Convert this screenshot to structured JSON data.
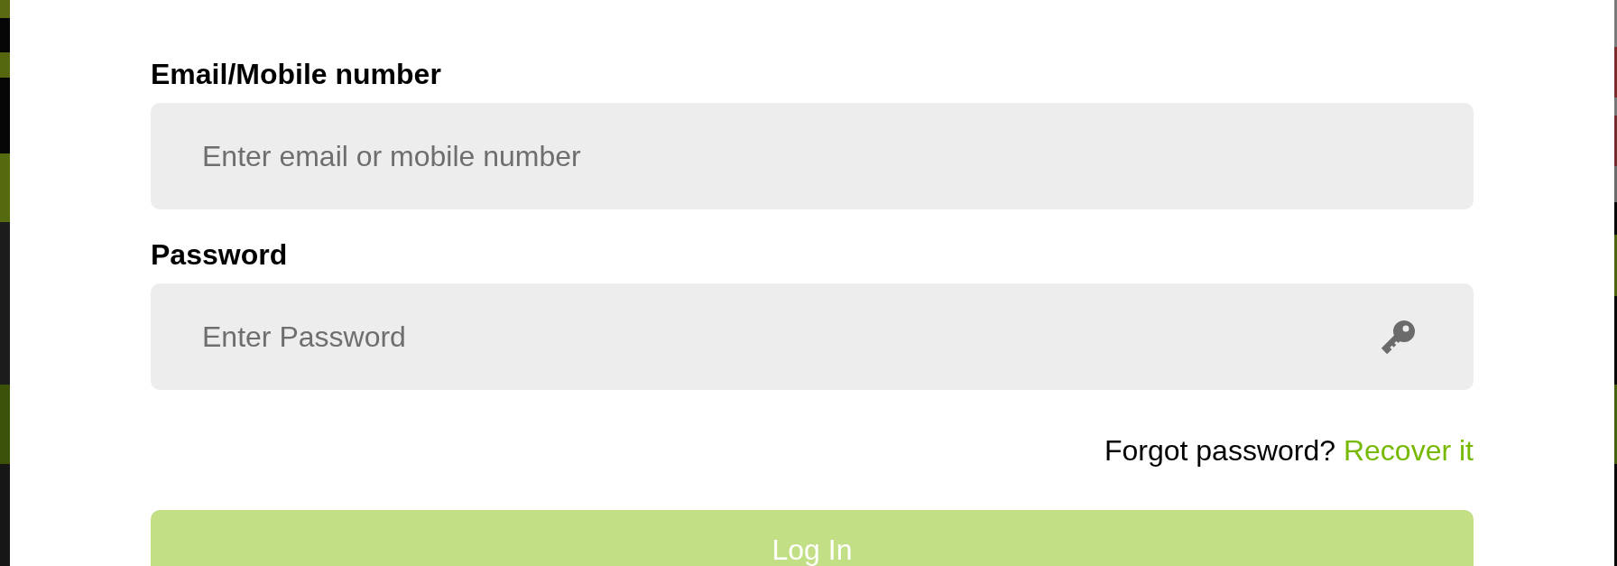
{
  "form": {
    "fields": [
      {
        "kind": "text",
        "label": "Email/Mobile number",
        "placeholder": "Enter email or mobile number"
      },
      {
        "kind": "password",
        "label": "Password",
        "placeholder": "Enter Password"
      }
    ],
    "recovery": {
      "prompt": "Forgot password?",
      "link": "Recover it"
    },
    "submit": {
      "label": "Log In",
      "disabled": true
    }
  }
}
